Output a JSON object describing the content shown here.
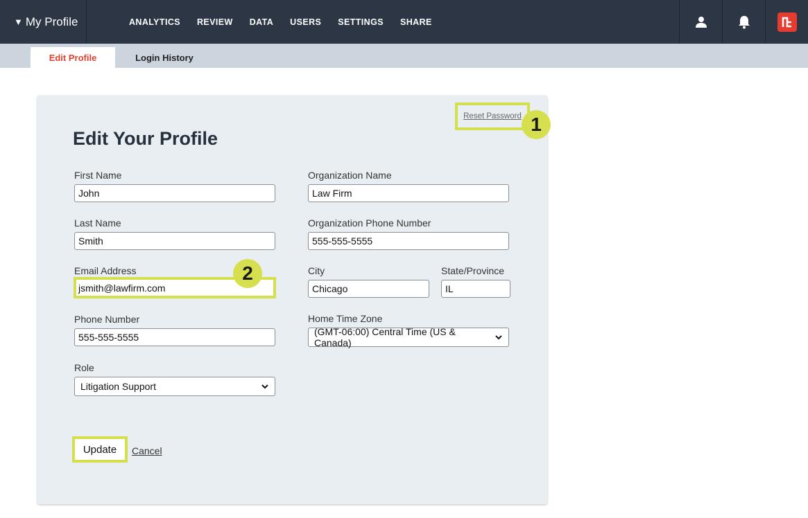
{
  "topbar": {
    "profile_menu_label": "My Profile",
    "profile_caret": "▼",
    "nav": [
      "ANALYTICS",
      "REVIEW",
      "DATA",
      "USERS",
      "SETTINGS",
      "SHARE"
    ],
    "icons": [
      "user-icon",
      "bell-icon",
      "brand-logo-icon"
    ]
  },
  "tabs": {
    "active": "Edit Profile",
    "inactive": "Login History"
  },
  "form": {
    "heading": "Edit Your Profile",
    "reset_password": "Reset Password",
    "callouts": [
      "1",
      "2"
    ],
    "first_name": {
      "label": "First Name",
      "value": "John"
    },
    "last_name": {
      "label": "Last Name",
      "value": "Smith"
    },
    "email": {
      "label": "Email Address",
      "value": "jsmith@lawfirm.com"
    },
    "phone": {
      "label": "Phone Number",
      "value": "555-555-5555"
    },
    "role": {
      "label": "Role",
      "value": "Litigation Support"
    },
    "org_name": {
      "label": "Organization Name",
      "value": "Law Firm"
    },
    "org_phone": {
      "label": "Organization Phone Number",
      "value": "555-555-5555"
    },
    "city": {
      "label": "City",
      "value": "Chicago"
    },
    "state": {
      "label": "State/Province",
      "value": "IL"
    },
    "time_zone": {
      "label": "Home Time Zone",
      "value": "(GMT-06:00) Central Time (US & Canada)"
    },
    "update_label": "Update",
    "cancel_label": "Cancel"
  },
  "colors": {
    "topbar": "#2c3645",
    "tabsbar": "#ccd5de",
    "active_tab_text": "#e0412f",
    "card": "#e8eef2",
    "highlight": "#d4df4e",
    "brand": "#e43d30"
  }
}
